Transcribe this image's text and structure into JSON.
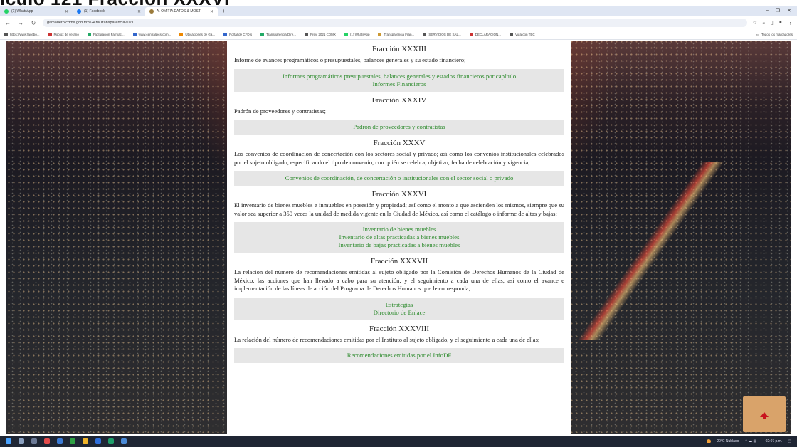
{
  "slide": {
    "title": "ículo 121 Fracción XXXVI"
  },
  "browser": {
    "tabs": [
      {
        "label": "(1) WhatsApp",
        "color": "#25d366",
        "active": false
      },
      {
        "label": "(1) Facebook",
        "color": "#1877f2",
        "active": false
      },
      {
        "label": "A. OMITIA DATOS & MOST",
        "color": "#9a7a3a",
        "active": true
      }
    ],
    "new_tab": "+",
    "window_controls": [
      "–",
      "❐",
      "✕"
    ],
    "address": "gamadero.cdmx.gob.mx/GAM/Transparencia2021/",
    "bookmarks": [
      {
        "label": "https://www.facebo...",
        "color": "#555"
      },
      {
        "label": "Roblox de verano",
        "color": "#c33"
      },
      {
        "label": "Facturación Farmac...",
        "color": "#2a6"
      },
      {
        "label": "www.centralpics.com...",
        "color": "#36c"
      },
      {
        "label": "Ubicaciones de Ga...",
        "color": "#e80"
      },
      {
        "label": "Portal de CFDIs",
        "color": "#36c"
      },
      {
        "label": "Transparencia Dire...",
        "color": "#2a6"
      },
      {
        "label": "Prev. 2021 CDMX",
        "color": "#555"
      },
      {
        "label": "(1) WhatsApp",
        "color": "#25d366"
      },
      {
        "label": "Transparencia Fran...",
        "color": "#c93"
      },
      {
        "label": "SERVICIOS DE SAL...",
        "color": "#555"
      },
      {
        "label": "DECLARACIÓN...",
        "color": "#c33"
      },
      {
        "label": "Vida con TEC",
        "color": "#555"
      }
    ],
    "all_bookmarks": "Todos los marcadores"
  },
  "sections": [
    {
      "title": "Fracción XXXIII",
      "desc": "Informe de avances programáticos o presupuestales, balances generales y su estado financiero;",
      "links": [
        "Informes programáticos presupuestales, balances generales y estados financieros por capítulo",
        "Informes Financieros"
      ]
    },
    {
      "title": "Fracción XXXIV",
      "desc": "Padrón de proveedores y contratistas;",
      "links": [
        "Padrón de proveedores y contratistas"
      ]
    },
    {
      "title": "Fracción XXXV",
      "desc": "Los convenios de coordinación de concertación con los sectores social y privado; así como los convenios institucionales celebrados por el sujeto obligado, especificando el tipo de convenio, con quién se celebra, objetivo, fecha de celebración y vigencia;",
      "links": [
        "Convenios de coordinación, de concertación o institucionales con el sector social o privado"
      ]
    },
    {
      "title": "Fracción XXXVI",
      "desc": "El inventario de bienes muebles e inmuebles en posesión y propiedad; así como el monto a que ascienden los mismos, siempre que su valor sea superior a 350 veces la unidad de medida vigente en la Ciudad de México, así como el catálogo o informe de altas y bajas;",
      "links": [
        "Inventario de bienes muebles",
        "Inventario de altas practicadas a bienes muebles",
        "Inventario de bajas practicadas a bienes muebles"
      ]
    },
    {
      "title": "Fracción XXXVII",
      "desc": "La relación del número de recomendaciones emitidas al sujeto obligado por la Comisión de Derechos Humanos de la Ciudad de México, las acciones que han llevado a cabo para su atención; y el seguimiento a cada una de ellas, así como el avance e implementación de las líneas de acción del Programa de Derechos Humanos que le corresponda;",
      "links": [
        "Estrategias",
        "Directorio de Enlace"
      ]
    },
    {
      "title": "Fracción XXXVIII",
      "desc": "La relación del número de recomendaciones emitidas por el Instituto al sujeto obligado, y el seguimiento a cada una de ellas;",
      "links": [
        "Recomendaciones emitidas por el InfoDF"
      ]
    }
  ],
  "taskbar": {
    "weather": "20°C Nublado",
    "time": "02:07 p.m."
  }
}
